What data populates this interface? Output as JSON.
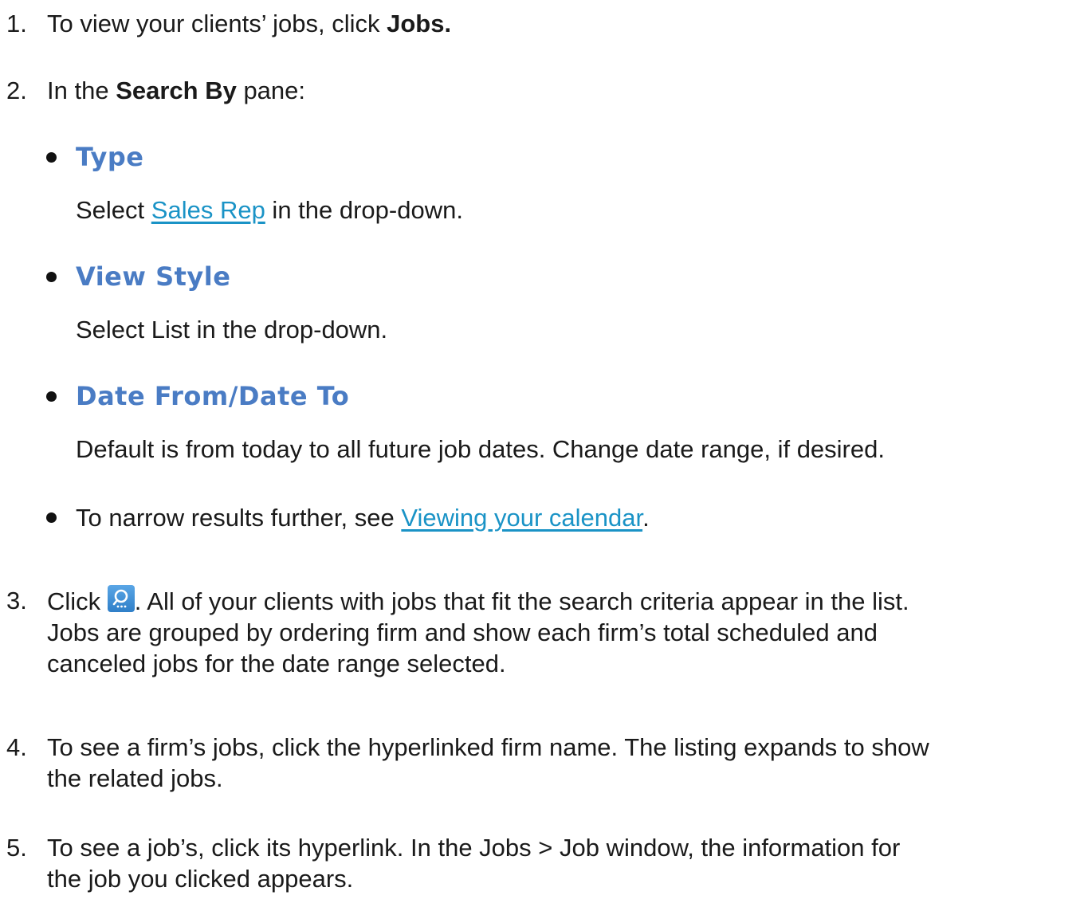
{
  "steps": [
    {
      "number": "1.",
      "prefix": "To view your clients’ jobs, click ",
      "bold": "Jobs."
    },
    {
      "number": "2.",
      "prefix": "In the ",
      "bold": "Search By",
      "suffix": " pane:",
      "bullets": [
        {
          "heading": "Type",
          "desc_prefix": "Select ",
          "desc_link": "Sales Rep",
          "desc_suffix": " in the drop-down."
        },
        {
          "heading": "View Style",
          "desc": "Select List in the drop-down."
        },
        {
          "heading": "Date From/Date To",
          "desc": "Default is from today to all future job dates. Change date range, if desired."
        }
      ],
      "extra_bullet": {
        "prefix": "To narrow results further, see ",
        "link": "Viewing your calendar",
        "suffix": "."
      }
    },
    {
      "number": "3.",
      "prefix": "Click ",
      "icon": "search-icon",
      "line1_rest": ". All of your clients with jobs that fit the search criteria appear in the list.",
      "line2": "Jobs are grouped by ordering firm and show each firm’s total scheduled and",
      "line3": "canceled jobs for the date range selected."
    },
    {
      "number": "4.",
      "line1": "To see a firm’s jobs, click the hyperlinked firm name. The listing expands to show",
      "line2": "the related jobs."
    },
    {
      "number": "5.",
      "line1": "To see a job’s, click its hyperlink. In the Jobs > Job window, the information for",
      "line2": "the job you clicked appears."
    }
  ],
  "colors": {
    "heading": "#4a7cc4",
    "link": "#1a93c6",
    "text": "#1a1a1a",
    "icon_bg": "#3a8dd4"
  }
}
